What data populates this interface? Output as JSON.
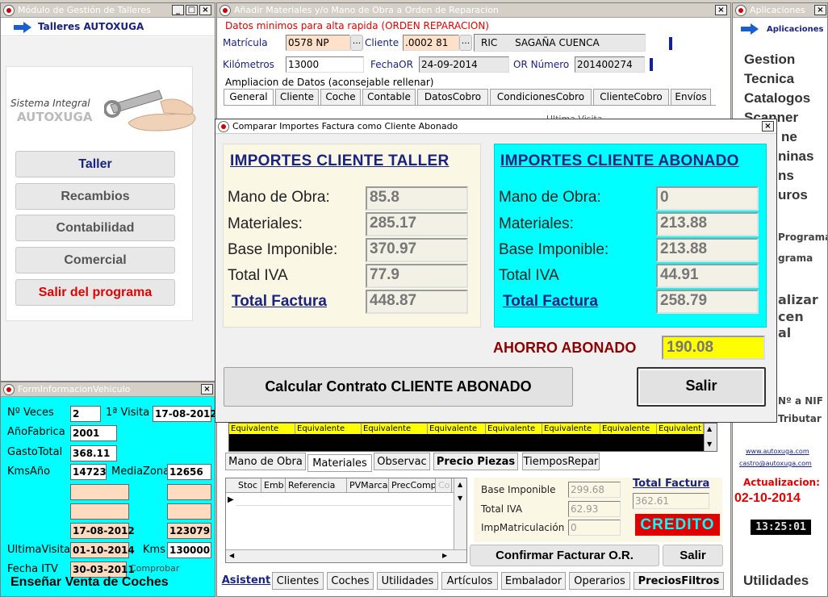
{
  "left_window": {
    "title": "Módulo de Gestión de Talleres",
    "header_label": "Talleres AUTOXUGA",
    "system_label_1": "Sistema Integral",
    "system_label_2": "AUTOXUGA",
    "buttons": [
      "Taller",
      "Recambios",
      "Contabilidad",
      "Comercial",
      "Salir del programa"
    ]
  },
  "vehicle_info": {
    "title": "FormInformacionVehiculo",
    "labels": {
      "veces": "Nº Veces",
      "primera_visita": "1ª Visita",
      "ano_fabric": "AñoFabrica",
      "gasto_total": "GastoTotal",
      "kms_ano": "KmsAño",
      "media_zona": "MediaZona",
      "ultima_visita": "UltimaVisita",
      "kms": "Kms",
      "fecha_itv": "Fecha ITV",
      "comprobar": "Comprobar",
      "ensenar": "Enseñar Venta de Coches"
    },
    "values": {
      "veces": "2",
      "primera_visita": "17-08-2012",
      "ano_fabric": "2001",
      "gasto_total": "368.11",
      "kms_ano": "14723",
      "media_zona": "12656",
      "blank_1": "",
      "blank_2": "",
      "blank_3": "",
      "blank_4": "",
      "date_mid": "17-08-2012",
      "num_mid": "123079",
      "ultima_visita": "01-10-2014",
      "kms": "130000",
      "fecha_itv": "30-03-2011"
    }
  },
  "main_window": {
    "title": "Añadir Materiales y/o Mano de Obra a Orden de Reparacion",
    "quick_title": "Datos minimos para alta rapida (ORDEN REPARACION)",
    "matricula_label": "Matrícula",
    "matricula_value": "0578 NP",
    "cliente_label": "Cliente",
    "cliente_value": ".0002 81",
    "cliente_name_1": "RIC",
    "cliente_name_2": "SAGAÑA CUENCA",
    "kilometros_label": "Kilómetros",
    "kilometros_value": "13000",
    "fechaor_label": "FechaOR",
    "fechaor_value": "24-09-2014",
    "ornumero_label": "OR Número",
    "ornumero_value": "201400274",
    "ampliacion_label": "Ampliacion de Datos (aconsejable rellenar)",
    "ultima_visita_partial": "Ultima Visita",
    "tabs": [
      "General",
      "Cliente",
      "Coche",
      "Contable",
      "DatosCobro",
      "CondicionesCobro",
      "ClienteCobro",
      "Envíos"
    ],
    "yellow_headers": [
      "Equivalente",
      "Equivalente",
      "Equivalente",
      "Equivalente",
      "Equivalente",
      "Equivalente",
      "Equivalente",
      "Equivalent"
    ],
    "lower_tabs": [
      "Mano de Obra",
      "Materiales",
      "Observac",
      "Precio Piezas",
      "TiemposRepar"
    ],
    "grid_cols": [
      "Stoc",
      "Emb",
      "Referencia",
      "PVMarca",
      "PrecComp",
      "Co"
    ],
    "base_imponible_label": "Base Imponible",
    "base_imponible_value": "299.68",
    "total_iva_label": "Total IVA",
    "total_iva_value": "62.93",
    "impmatric_label": "ImpMatriculación",
    "impmatric_value": "0",
    "total_factura_label": "Total Factura",
    "total_factura_value": "362.61",
    "credito": "CREDITO",
    "confirmar": "Confirmar Facturar O.R.",
    "salir": "Salir",
    "bottom_tabs": [
      "Asistent",
      "Clientes",
      "Coches",
      "Utilidades",
      "Artículos",
      "Embalador",
      "Operarios",
      "PreciosFiltros"
    ]
  },
  "apps_window": {
    "title": "Aplicaciones",
    "header": "Aplicaciones",
    "menu": [
      "Gestion",
      "Tecnica",
      "Catalogos",
      "Scanner",
      "ne",
      "ninas",
      "ns",
      "uros"
    ],
    "fragments": [
      "Programa",
      "grama",
      "alizar",
      "cen",
      "al",
      "Nº a NIF",
      "Tributar"
    ],
    "link_1": "www.autoxuga.com",
    "link_2": "castro@autoxuga.com",
    "actualizacion_label": "Actualizacion:",
    "actualizacion_date": "02-10-2014",
    "clock": "13:25:01",
    "utilidades": "Utilidades"
  },
  "dialog": {
    "title": "Comparar Importes Factura como Cliente Abonado",
    "left_header": "IMPORTES CLIENTE TALLER",
    "right_header": "IMPORTES CLIENTE ABONADO",
    "row_labels": [
      "Mano de Obra:",
      "Materiales:",
      "Base Imponible:",
      "Total IVA",
      "Total Factura"
    ],
    "taller_values": [
      "85.8",
      "285.17",
      "370.97",
      "77.9",
      "448.87"
    ],
    "abonado_values": [
      "0",
      "213.88",
      "213.88",
      "44.91",
      "258.79"
    ],
    "ahorro_label": "AHORRO ABONADO",
    "ahorro_value": "190.08",
    "calc_button": "Calcular Contrato CLIENTE ABONADO",
    "salir_button": "Salir"
  },
  "colors": {
    "cyan": "#00ffff",
    "cream": "#fbf7e5",
    "accent_red": "#e00000",
    "dark_red": "#8b0000",
    "navy": "#1a237e",
    "yellow": "#ffff00"
  }
}
